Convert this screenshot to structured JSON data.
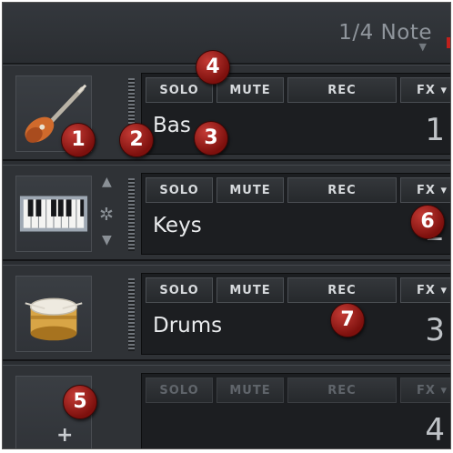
{
  "header": {
    "note_value": "1/4 Note"
  },
  "buttons": {
    "solo": "SOLO",
    "mute": "MUTE",
    "rec": "REC",
    "fx": "FX ▾"
  },
  "tracks": [
    {
      "name": "Bas",
      "number": "1",
      "instrument": "guitar-icon"
    },
    {
      "name": "Keys",
      "number": "2",
      "instrument": "keyboard-icon"
    },
    {
      "name": "Drums",
      "number": "3",
      "instrument": "drum-icon"
    },
    {
      "name": "",
      "number": "4",
      "instrument": "add-track-icon",
      "add_label": "+"
    }
  ],
  "callouts": [
    "1",
    "2",
    "3",
    "4",
    "5",
    "6",
    "7"
  ],
  "colors": {
    "background": "#2b2e32",
    "panel": "#1c1e21",
    "badge": "#a11f1a",
    "text": "#e9ebed"
  }
}
